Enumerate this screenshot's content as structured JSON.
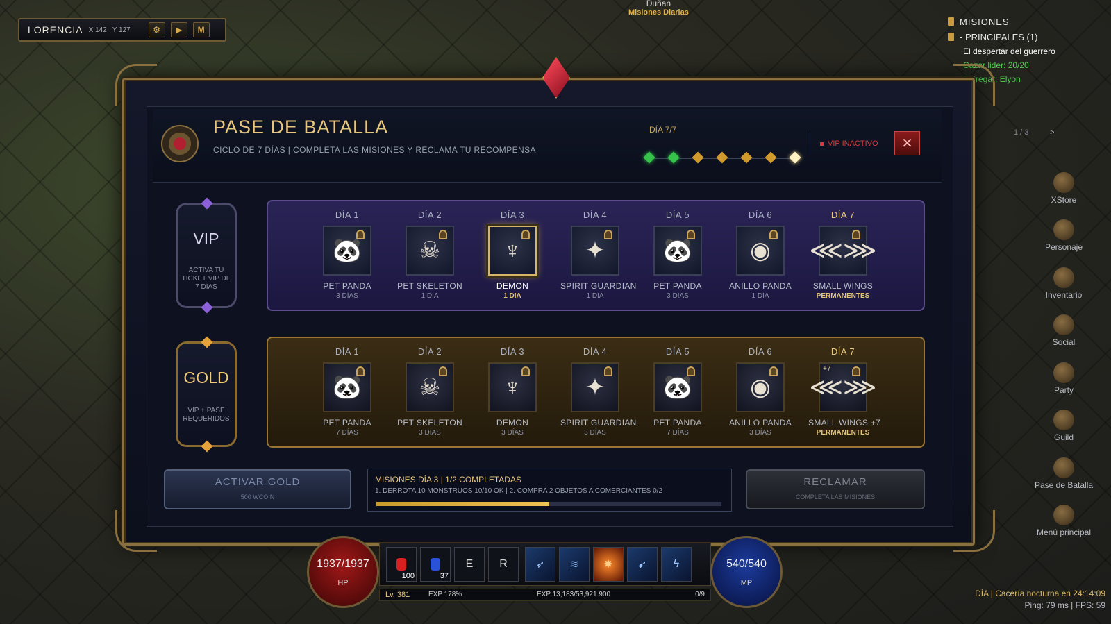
{
  "location": {
    "name": "LORENCIA",
    "x": "X 142",
    "y": "Y 127",
    "btn_settings": "⚙",
    "btn_play": "▶",
    "btn_map": "M"
  },
  "npc": {
    "name": "Duñan",
    "subtitle": "Misiones Diarias"
  },
  "missions_panel": {
    "title": "MISIONES",
    "category": "- PRINCIPALES (1)",
    "quest": "El despertar del guerrero",
    "progress": "Cazar lider: 20/20",
    "turn_in": "Entregar: Elyon",
    "page": "1 / 3",
    "next": ">"
  },
  "side_menu": [
    "XStore",
    "Personaje",
    "Inventario",
    "Social",
    "Party",
    "Guild",
    "Pase de Batalla",
    "Menú principal"
  ],
  "battle_pass": {
    "title": "PASE DE BATALLA",
    "subtitle": "CICLO DE 7 DÍAS | COMPLETA LAS MISIONES Y RECLAMA TU RECOMPENSA",
    "day_label": "DÍA 7/7",
    "progress_days_done": 2,
    "progress_days_total": 7,
    "vip_status": "VIP INACTIVO",
    "close": "✕",
    "vip_tier": {
      "name": "VIP",
      "desc": "ACTIVA TU TICKET VIP DE 7 DÍAS"
    },
    "gold_tier": {
      "name": "GOLD",
      "desc": "VIP + PASE REQUERIDOS"
    },
    "vip_rewards": [
      {
        "day": "DÍA 1",
        "name": "PET PANDA",
        "dur": "3 DÍAS",
        "icon": "panda"
      },
      {
        "day": "DÍA 2",
        "name": "PET SKELETON",
        "dur": "1 DÍA",
        "icon": "skeleton"
      },
      {
        "day": "DÍA 3",
        "name": "DEMON",
        "dur": "1 DÍA",
        "icon": "demon"
      },
      {
        "day": "DÍA 4",
        "name": "SPIRIT GUARDIAN",
        "dur": "1 DÍA",
        "icon": "spirit"
      },
      {
        "day": "DÍA 5",
        "name": "PET PANDA",
        "dur": "3 DÍAS",
        "icon": "panda"
      },
      {
        "day": "DÍA 6",
        "name": "ANILLO PANDA",
        "dur": "1 DÍA",
        "icon": "ring"
      },
      {
        "day": "DÍA 7",
        "name": "SMALL WINGS",
        "dur": "PERMANENTES",
        "icon": "wings"
      }
    ],
    "gold_rewards": [
      {
        "day": "DÍA 1",
        "name": "PET PANDA",
        "dur": "7 DÍAS",
        "icon": "panda"
      },
      {
        "day": "DÍA 2",
        "name": "PET SKELETON",
        "dur": "3 DÍAS",
        "icon": "skeleton"
      },
      {
        "day": "DÍA 3",
        "name": "DEMON",
        "dur": "3 DÍAS",
        "icon": "demon"
      },
      {
        "day": "DÍA 4",
        "name": "SPIRIT GUARDIAN",
        "dur": "3 DÍAS",
        "icon": "spirit"
      },
      {
        "day": "DÍA 5",
        "name": "PET PANDA",
        "dur": "7 DÍAS",
        "icon": "panda"
      },
      {
        "day": "DÍA 6",
        "name": "ANILLO PANDA",
        "dur": "3 DÍAS",
        "icon": "ring"
      },
      {
        "day": "DÍA 7",
        "name": "SMALL WINGS +7",
        "dur": "PERMANENTES",
        "icon": "wings",
        "plus": "+7"
      }
    ],
    "activate_gold": {
      "label": "ACTIVAR GOLD",
      "cost": "500 WCOIN"
    },
    "daily_missions": {
      "title": "MISIONES DÍA 3 | 1/2 COMPLETADAS",
      "detail": "1. DERROTA 10 MONSTRUOS 10/10 OK | 2. COMPRA 2 OBJETOS A COMERCIANTES 0/2",
      "progress": 0.5
    },
    "claim": {
      "label": "RECLAMAR",
      "hint": "COMPLETA LAS MISIONES"
    }
  },
  "hud": {
    "hp": "1937/1937",
    "hp_label": "HP",
    "mp": "540/540",
    "mp_label": "MP",
    "potion_red_qty": "100",
    "potion_blue_qty": "37",
    "key_e": "E",
    "key_r": "R",
    "level": "Lv. 381",
    "exp_pct": "EXP 178%",
    "exp": "EXP 13,183/53,921.900",
    "exp_frac": "0/9"
  },
  "status": {
    "event": "DÍA | Cacería nocturna en 24:14:09",
    "perf": "Ping: 79 ms | FPS: 59"
  }
}
